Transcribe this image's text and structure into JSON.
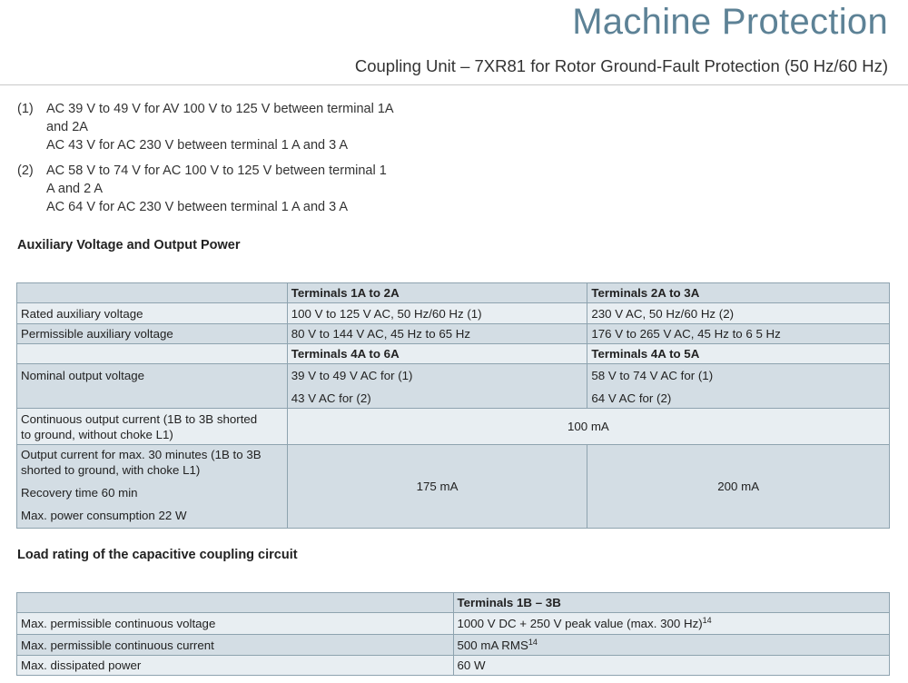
{
  "header": {
    "title": "Machine Protection",
    "subtitle": "Coupling Unit – 7XR81 for Rotor Ground-Fault Protection (50 Hz/60 Hz)"
  },
  "footnotes": [
    {
      "num": "(1)",
      "lines": [
        "AC 39 V to 49 V for AV 100 V to 125 V between terminal 1A",
        "and 2A",
        "AC 43 V for AC 230 V between terminal 1 A and 3 A"
      ]
    },
    {
      "num": "(2)",
      "lines": [
        "AC 58 V to 74 V for AC 100 V to 125 V between terminal 1",
        "A and 2 A",
        "AC 64 V for AC 230 V between terminal 1 A and 3 A"
      ]
    }
  ],
  "section1": {
    "heading": "Auxiliary Voltage and Output Power",
    "head_a": "Terminals 1A to 2A",
    "head_b": "Terminals 2A to 3A",
    "rated_label": "Rated auxiliary voltage",
    "rated_a": "100 V to 125 V AC, 50 Hz/60 Hz (1)",
    "rated_b": "230 V AC, 50 Hz/60 Hz (2)",
    "perm_label": "Permissible auxiliary voltage",
    "perm_a": "80 V to 144 V AC, 45 Hz to 65 Hz",
    "perm_b": "176 V to 265 V AC, 45 Hz to 6 5 Hz",
    "head_c": "Terminals 4A to 6A",
    "head_d": "Terminals 4A to 5A",
    "nominal_label": "Nominal output voltage",
    "nominal_a1": "39 V to 49 V AC for (1)",
    "nominal_a2": "43 V AC for (2)",
    "nominal_b1": "58 V to 74 V AC for (1)",
    "nominal_b2": "64 V AC for (2)",
    "cont_label_1": "Continuous output current (1B to 3B shorted",
    "cont_label_2": "to ground, without choke L1)",
    "cont_value": "100 mA",
    "out_label_1": "Output current for max. 30 minutes (1B to 3B",
    "out_label_2": "shorted to ground, with choke L1)",
    "out_label_3": "Recovery time 60 min",
    "out_label_4": "Max. power consumption 22 W",
    "out_a": "175 mA",
    "out_b": "200 mA"
  },
  "section2": {
    "heading": "Load rating of the capacitive coupling circuit",
    "head": "Terminals 1B – 3B",
    "rows": [
      {
        "label": "Max. permissible continuous voltage",
        "value": "1000 V DC + 250 V peak value (max. 300 Hz)",
        "sup": "14"
      },
      {
        "label": "Max. permissible continuous current",
        "value": "500 mA RMS",
        "sup": "14"
      },
      {
        "label": "Max. dissipated power",
        "value": "60 W",
        "sup": ""
      }
    ]
  }
}
